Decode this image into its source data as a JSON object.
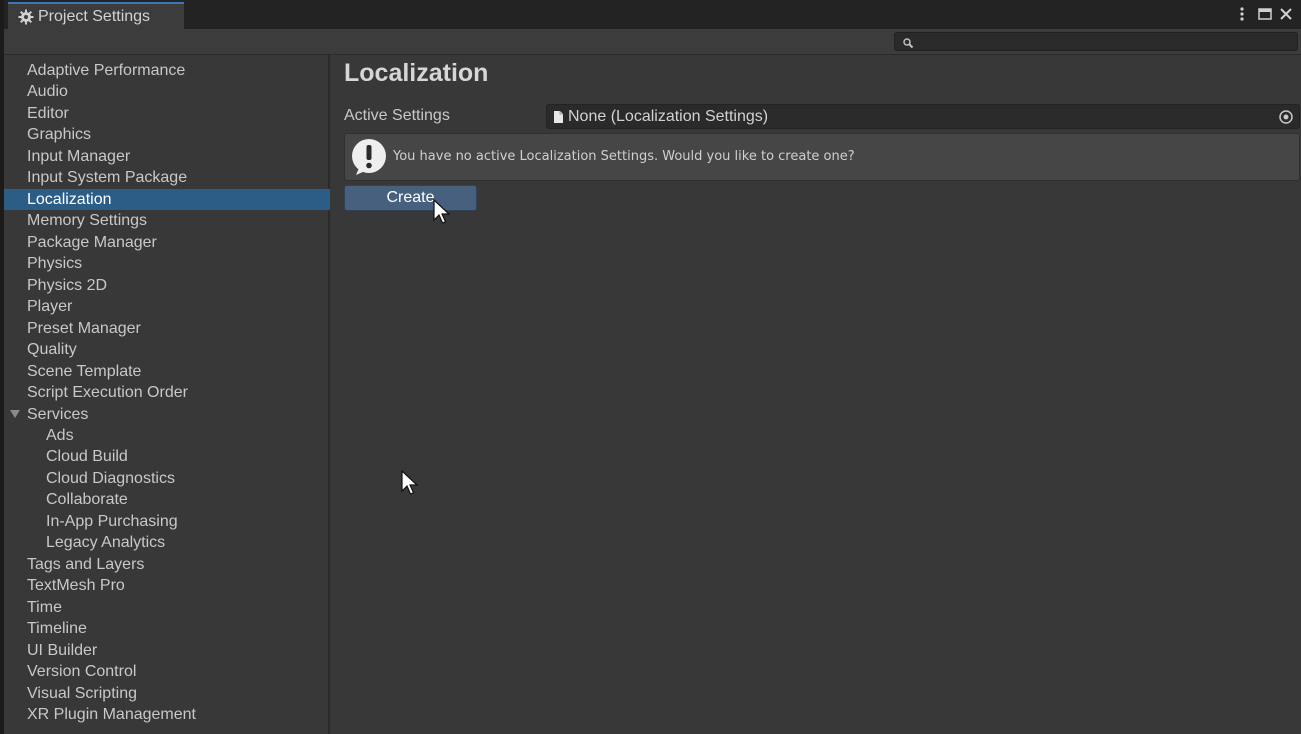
{
  "window": {
    "tab_title": "Project Settings",
    "tab_icon": "gear-icon",
    "controls": [
      "more-options-icon",
      "maximize-icon",
      "close-icon"
    ]
  },
  "toolbar": {
    "search_placeholder": ""
  },
  "sidebar": {
    "items": [
      {
        "label": "Adaptive Performance",
        "level": 0
      },
      {
        "label": "Audio",
        "level": 0
      },
      {
        "label": "Editor",
        "level": 0
      },
      {
        "label": "Graphics",
        "level": 0
      },
      {
        "label": "Input Manager",
        "level": 0
      },
      {
        "label": "Input System Package",
        "level": 0
      },
      {
        "label": "Localization",
        "level": 0,
        "selected": true
      },
      {
        "label": "Memory Settings",
        "level": 0
      },
      {
        "label": "Package Manager",
        "level": 0
      },
      {
        "label": "Physics",
        "level": 0
      },
      {
        "label": "Physics 2D",
        "level": 0
      },
      {
        "label": "Player",
        "level": 0
      },
      {
        "label": "Preset Manager",
        "level": 0
      },
      {
        "label": "Quality",
        "level": 0
      },
      {
        "label": "Scene Template",
        "level": 0
      },
      {
        "label": "Script Execution Order",
        "level": 0
      },
      {
        "label": "Services",
        "level": 0,
        "expanded": true
      },
      {
        "label": "Ads",
        "level": 1
      },
      {
        "label": "Cloud Build",
        "level": 1
      },
      {
        "label": "Cloud Diagnostics",
        "level": 1
      },
      {
        "label": "Collaborate",
        "level": 1
      },
      {
        "label": "In-App Purchasing",
        "level": 1
      },
      {
        "label": "Legacy Analytics",
        "level": 1
      },
      {
        "label": "Tags and Layers",
        "level": 0
      },
      {
        "label": "TextMesh Pro",
        "level": 0
      },
      {
        "label": "Time",
        "level": 0
      },
      {
        "label": "Timeline",
        "level": 0
      },
      {
        "label": "UI Builder",
        "level": 0
      },
      {
        "label": "Version Control",
        "level": 0
      },
      {
        "label": "Visual Scripting",
        "level": 0
      },
      {
        "label": "XR Plugin Management",
        "level": 0
      }
    ]
  },
  "content": {
    "title": "Localization",
    "active_settings_label": "Active Settings",
    "active_settings_value": "None (Localization Settings)",
    "help_message": "You have no active Localization Settings. Would you like to create one?",
    "create_label": "Create"
  },
  "colors": {
    "accent": "#2c5d87",
    "button": "#46607e",
    "background": "#383838"
  }
}
